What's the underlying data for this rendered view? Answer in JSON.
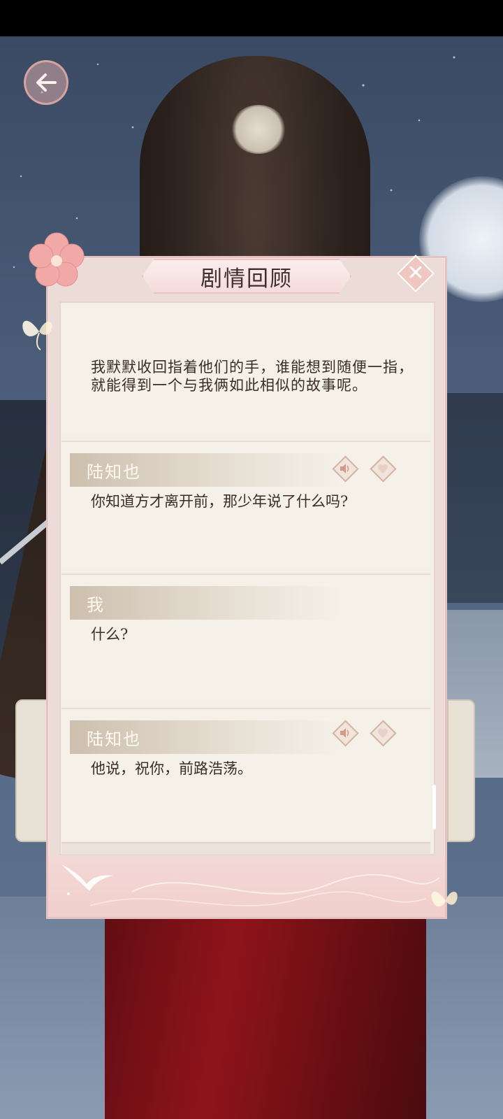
{
  "dialog": {
    "title": "剧情回顾",
    "close_icon": "close-icon",
    "close_glyph": "✕"
  },
  "navigation": {
    "back_icon": "back-arrow-icon"
  },
  "entries": [
    {
      "type": "narration",
      "text": "我默默收回指着他们的手，谁能想到随便一指，就能得到一个与我俩如此相似的故事呢。"
    },
    {
      "type": "dialogue",
      "speaker": "陆知也",
      "text": "你知道方才离开前，那少年说了什么吗?",
      "has_voice": true,
      "has_favorite": true
    },
    {
      "type": "dialogue",
      "speaker": "我",
      "text": "什么?",
      "has_voice": false,
      "has_favorite": false
    },
    {
      "type": "dialogue",
      "speaker": "陆知也",
      "text": "他说，祝你，前路浩荡。",
      "has_voice": true,
      "has_favorite": true
    }
  ],
  "colors": {
    "dialog_border": "#e6c2c0",
    "paper": "#f4f0e8",
    "text": "#3a2c27",
    "speaker_band": "#cdbfae"
  }
}
